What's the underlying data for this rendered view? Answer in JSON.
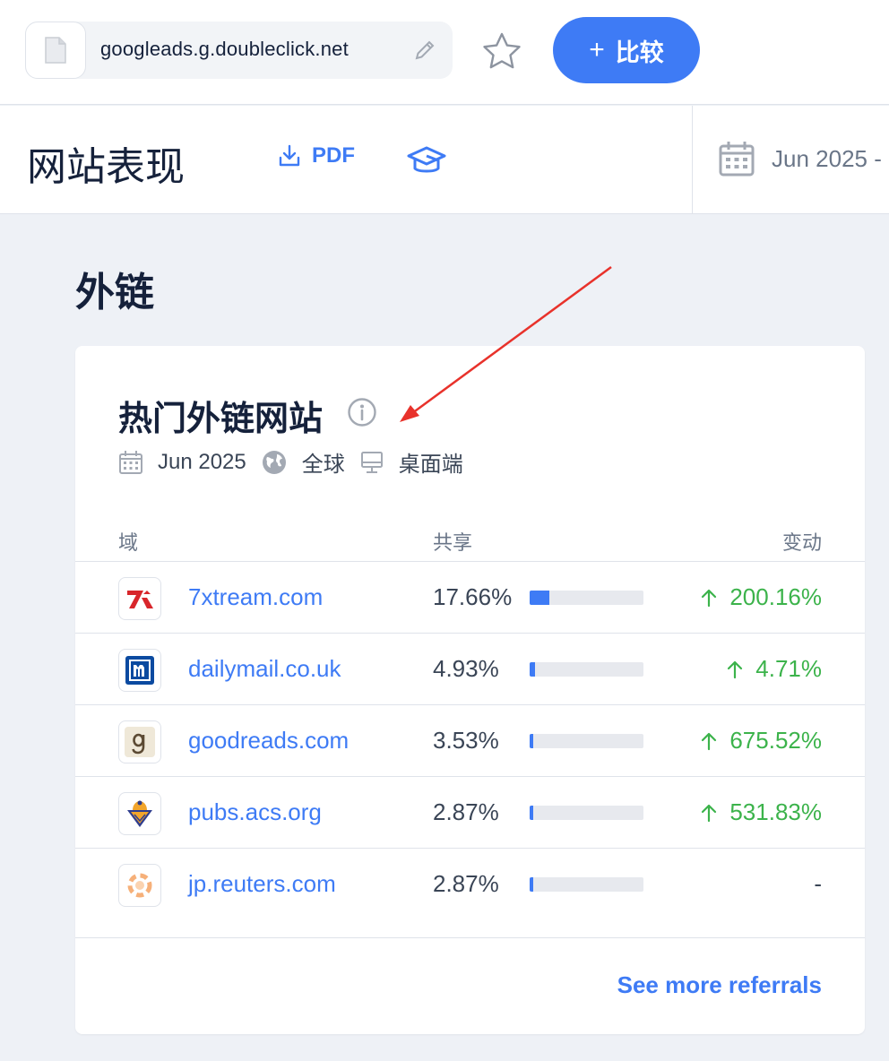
{
  "topbar": {
    "domain": "googleads.g.doubleclick.net",
    "compare_plus": "+",
    "compare_label": "比较"
  },
  "header": {
    "title": "网站表现",
    "pdf_label": "PDF",
    "date": "Jun 2025 -"
  },
  "section": {
    "title": "外链"
  },
  "card": {
    "title": "热门外链网站",
    "filters": {
      "date": "Jun 2025",
      "region": "全球",
      "device": "桌面端"
    },
    "columns": {
      "domain": "域",
      "share": "共享",
      "change": "变动"
    },
    "rows": [
      {
        "site": "7xtream.com",
        "share": "17.66%",
        "share_value": 17.66,
        "change": "200.16%",
        "trend": "up"
      },
      {
        "site": "dailymail.co.uk",
        "share": "4.93%",
        "share_value": 4.93,
        "change": "4.71%",
        "trend": "up"
      },
      {
        "site": "goodreads.com",
        "share": "3.53%",
        "share_value": 3.53,
        "change": "675.52%",
        "trend": "up"
      },
      {
        "site": "pubs.acs.org",
        "share": "2.87%",
        "share_value": 2.87,
        "change": "531.83%",
        "trend": "up"
      },
      {
        "site": "jp.reuters.com",
        "share": "2.87%",
        "share_value": 2.87,
        "change": "-",
        "trend": "none"
      }
    ],
    "see_more": "See more referrals"
  },
  "colors": {
    "accent": "#3e7bf5",
    "positive": "#3cb34b",
    "annotation_arrow": "#e8322b"
  }
}
